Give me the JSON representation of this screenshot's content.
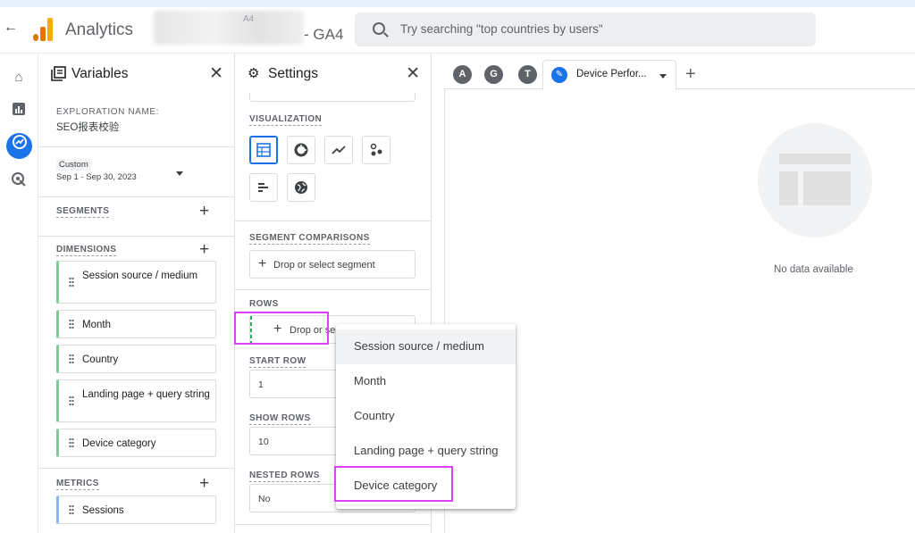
{
  "topbar": {
    "back_icon": "arrow-back-icon",
    "app_name": "Analytics",
    "account_fragment": "A4",
    "property": "- GA4",
    "search_placeholder": "Try searching \"top countries by users\""
  },
  "rail": {
    "items": [
      "home-icon",
      "reports-icon",
      "explore-icon",
      "advertising-icon"
    ],
    "active": "explore-icon",
    "accent": "#1a73e8"
  },
  "variables": {
    "title": "Variables",
    "exploration_name_label": "EXPLORATION NAME:",
    "exploration_name": "SEO报表校验",
    "date_preset": "Custom",
    "date_range": "Sep 1 - Sep 30, 2023",
    "segments_label": "SEGMENTS",
    "dimensions_label": "DIMENSIONS",
    "dimensions": [
      "Session source / medium",
      "Month",
      "Country",
      "Landing page + query string",
      "Device category"
    ],
    "metrics_label": "METRICS",
    "metrics": [
      "Sessions"
    ]
  },
  "settings": {
    "title": "Settings",
    "visualization_label": "VISUALIZATION",
    "segment_comparisons_label": "SEGMENT COMPARISONS",
    "segment_drop": "Drop or select segment",
    "rows_label": "ROWS",
    "rows_drop": "Drop or sele",
    "start_row_label": "START ROW",
    "start_row": "1",
    "show_rows_label": "SHOW ROWS",
    "show_rows": "10",
    "nested_rows_label": "NESTED ROWS",
    "nested_rows": "No"
  },
  "tabs": {
    "avatars": [
      "A",
      "G",
      "T"
    ],
    "active_tab": "Device Perfor...",
    "add_icon": "plus-icon"
  },
  "canvas": {
    "empty_text": "No data available"
  },
  "dropdown": {
    "items": [
      "Session source / medium",
      "Month",
      "Country",
      "Landing page + query string",
      "Device category"
    ],
    "hovered": "Session source / medium",
    "highlighted": "Device category"
  },
  "colors": {
    "highlight": "#e040fb",
    "dimension": "#81c995",
    "metric": "#8ab4f8"
  }
}
